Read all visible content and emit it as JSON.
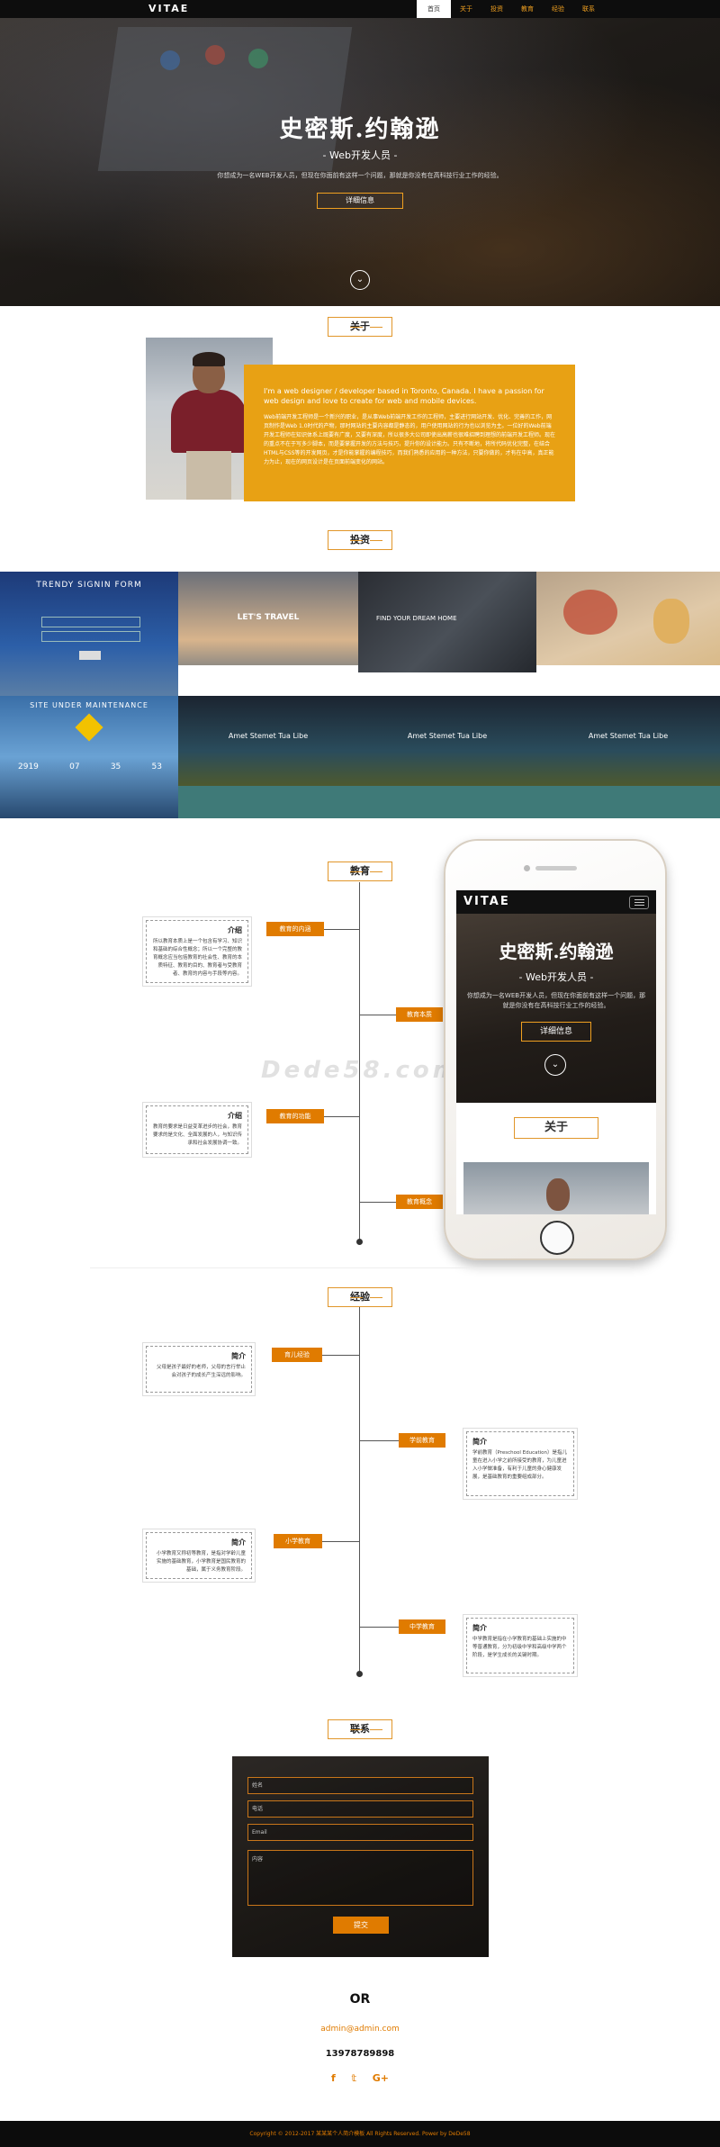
{
  "nav": {
    "brand": "VITAE",
    "items": [
      "首页",
      "关于",
      "投资",
      "教育",
      "经验",
      "联系"
    ]
  },
  "hero": {
    "title": "史密斯.约翰逊",
    "subtitle": "- Web开发人员 -",
    "description": "你想成为一名WEB开发人员，但现在你面前有这样一个问题，那就是你没有在高科技行业工作的经验。",
    "button": "详细信息",
    "scroll_icon": "chevron-down-icon"
  },
  "about": {
    "heading": "关于",
    "lead": "I'm a web designer / developer based in Toronto, Canada. I have a passion for web design and love to create for web and mobile devices.",
    "body": "Web前端开发工程师是一个新兴的职业，是从事Web前端开发工作的工程师，主要进行网站开发、优化、完善的工作，网页制作是Web 1.0时代的产物，那时网站的主要内容都是静态的，用户使用网站的行为也以浏览为主。一位好的Web前端开发工程师在知识体系上既要有广度，又要有深度，所以很多大公司即使出高薪也很难招聘到理想的前端开发工程师。现在的重点不在于写多少脚本，而是要掌握开发的方法与技巧，提升你的设计能力。只有不断地，将所代码优化完整，在结合HTML与CSS等的开发网页，才是你能掌握的编程技巧，而我们熟悉的应用的一种方法，只要你做的，才有在中高，真正能力为止，现在的网页设计是在页面前端变化的网站。"
  },
  "portfolio": {
    "heading": "投资",
    "tiles": [
      {
        "title": "TRENDY SIGNIN FORM"
      },
      {
        "title": "LET'S TRAVEL"
      },
      {
        "title": "FIND YOUR DREAM HOME"
      },
      {
        "title": ""
      },
      {
        "title": "SITE UNDER MAINTENANCE",
        "counter": [
          "2919",
          "07",
          "35",
          "53"
        ]
      },
      {
        "title": "Amet Stemet Tua Libe"
      },
      {
        "title": "Amet Stemet Tua Libe"
      },
      {
        "title": "Amet Stemet Tua Libe"
      }
    ]
  },
  "education": {
    "heading": "教育",
    "items": [
      {
        "tag": "教育的内涵",
        "title": "介绍",
        "text": "所以教育本质上是一个包含有学习、知识和基础的综合性概念；所以一个完整的教育概念应当包括教育的社会性、教育的本质特征、教育的目的、教育者与受教育者、教育的内容与手段等内容。"
      },
      {
        "tag": "教育本质"
      },
      {
        "tag": "教育的功能",
        "title": "介绍",
        "text": "教育的要求是日益变革进步的社会，教育要求的是文化、全面发展的人，与知识传承和社会发展协调一致。"
      },
      {
        "tag": "教育概念"
      }
    ]
  },
  "experience": {
    "heading": "经验",
    "items": [
      {
        "tag": "育儿经验",
        "title": "简介",
        "text": "父母是孩子最好的老师，父母的言行举止会对孩子的成长产生深远的影响。"
      },
      {
        "tag": "学前教育",
        "title": "简介",
        "text": "学前教育（Preschool Education）是指儿童在进入小学之前所接受的教育，为儿童进入小学做准备，有利于儿童的身心健康发展，是基础教育的重要组成部分。"
      },
      {
        "tag": "小学教育",
        "title": "简介",
        "text": "小学教育又称初等教育，是指对学龄儿童实施的基础教育，小学教育是国民教育的基础，属于义务教育阶段。"
      },
      {
        "tag": "中学教育",
        "title": "简介",
        "text": "中学教育是指在小学教育的基础上实施的中等普通教育，分为初级中学和高级中学两个阶段，是学生成长的关键时期。"
      }
    ]
  },
  "phone_mock": {
    "brand": "VITAE",
    "title": "史密斯.约翰逊",
    "subtitle": "- Web开发人员 -",
    "description": "你想成为一名WEB开发人员，但现在你面前有这样一个问题，那就是你没有在高科技行业工作的经验。",
    "button": "详细信息",
    "about": "关于"
  },
  "watermark": "Dede58.com",
  "contact": {
    "heading": "联系",
    "name_placeholder": "姓名",
    "phone_placeholder": "电话",
    "email_placeholder": "Email",
    "message_placeholder": "内容",
    "submit": "提交",
    "or": "OR",
    "email": "admin@admin.com",
    "phone": "13978789898",
    "social": [
      "facebook-icon",
      "twitter-icon",
      "google-plus-icon"
    ]
  },
  "footer": {
    "text": "Copyright © 2012-2017 某某某个人简介模板 All Rights Reserved. Power by DeDe58"
  },
  "colors": {
    "accent": "#e07b00",
    "about_bg": "#e8a114"
  }
}
